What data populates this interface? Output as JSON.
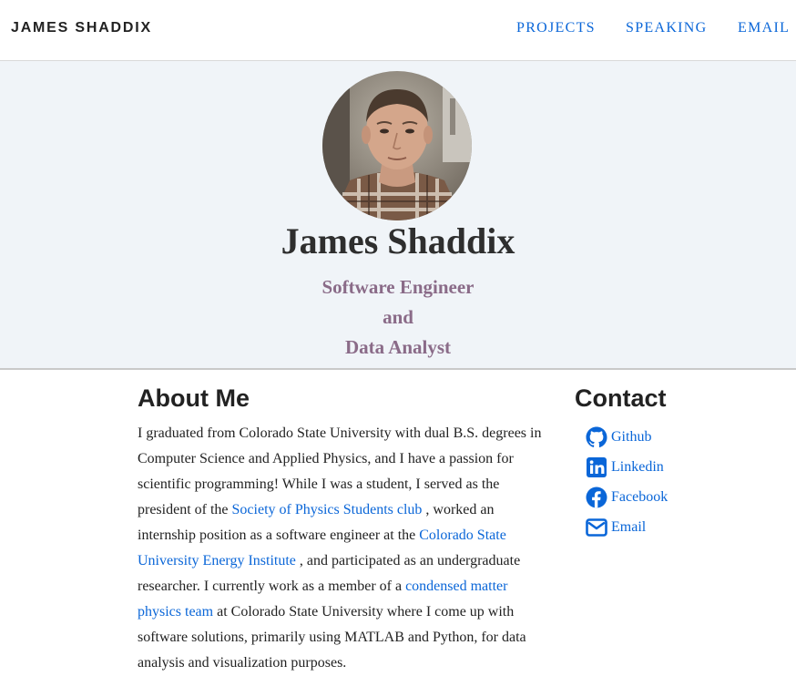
{
  "navbar": {
    "brand": "JAMES SHADDIX",
    "links": [
      {
        "label": "PROJECTS"
      },
      {
        "label": "SPEAKING"
      },
      {
        "label": "EMAIL"
      }
    ]
  },
  "hero": {
    "name": "James Shaddix",
    "subtitle_lines": [
      "Software Engineer",
      "and",
      "Data Analyst"
    ]
  },
  "about": {
    "heading": "About Me",
    "text_1": "I graduated from Colorado State University with dual B.S. degrees in Computer Science and Applied Physics, and I have a passion for scientific programming! While I was a student, I served as the president of the ",
    "link_1": "Society of Physics Students club",
    "text_2": " , worked an internship position as a software engineer at the ",
    "link_2": "Colorado State University Energy Institute",
    "text_3": " , and participated as an undergraduate researcher. I currently work as a member of a ",
    "link_3": "condensed matter physics team",
    "text_4": " at Colorado State University where I come up with software solutions, primarily using MATLAB and Python, for data analysis and visualization purposes."
  },
  "contact": {
    "heading": "Contact",
    "items": [
      {
        "label": "Github",
        "icon": "github-icon"
      },
      {
        "label": "Linkedin",
        "icon": "linkedin-icon"
      },
      {
        "label": "Facebook",
        "icon": "facebook-icon"
      },
      {
        "label": "Email",
        "icon": "email-icon"
      }
    ]
  },
  "colors": {
    "link": "#0a66d8",
    "subtitle": "#8a6b88",
    "hero_bg": "#f0f4f8"
  }
}
